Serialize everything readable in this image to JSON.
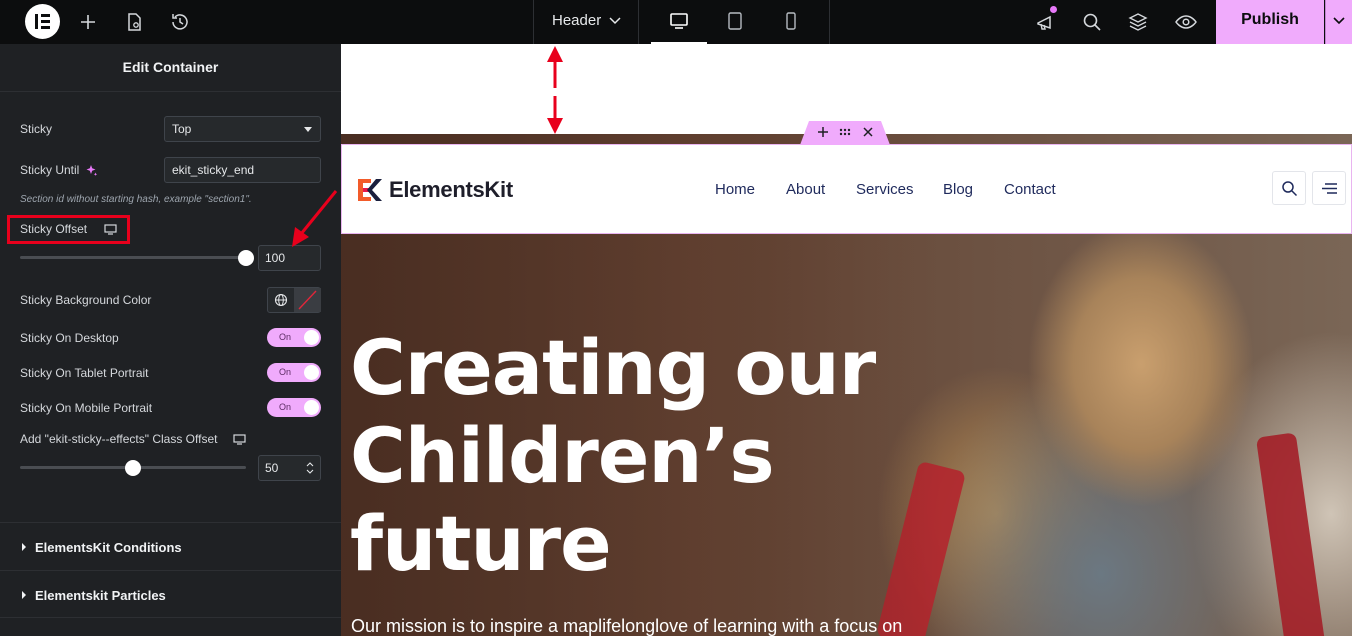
{
  "topbar": {
    "document_label": "Header",
    "publish_label": "Publish"
  },
  "panel": {
    "title": "Edit Container",
    "sticky": {
      "label": "Sticky",
      "value": "Top"
    },
    "sticky_until": {
      "label": "Sticky Until",
      "value": "ekit_sticky_end"
    },
    "hint": "Section id without starting hash, example \"section1\".",
    "sticky_offset": {
      "label": "Sticky Offset",
      "value": "100",
      "slider_level": 1.0
    },
    "sticky_bg": {
      "label": "Sticky Background Color"
    },
    "toggles": [
      {
        "label": "Sticky On Desktop",
        "state": "On"
      },
      {
        "label": "Sticky On Tablet Portrait",
        "state": "On"
      },
      {
        "label": "Sticky On Mobile Portrait",
        "state": "On"
      }
    ],
    "class_offset": {
      "label": "Add \"ekit-sticky--effects\" Class Offset",
      "value": "50",
      "slider_level": 0.5
    },
    "sections": [
      {
        "label": "ElementsKit Conditions"
      },
      {
        "label": "Elementskit Particles"
      }
    ]
  },
  "preview": {
    "brand": "ElementsKit",
    "nav": [
      "Home",
      "About",
      "Services",
      "Blog",
      "Contact"
    ],
    "hero_title": [
      "Creating our",
      "Children’s",
      "future"
    ],
    "hero_sub": "Our mission is to inspire a maplifelonglove of learning with a focus on"
  },
  "colors": {
    "accent": "#f0abfc",
    "highlight": "#e8001c",
    "nav_text": "#1f2a5c"
  }
}
